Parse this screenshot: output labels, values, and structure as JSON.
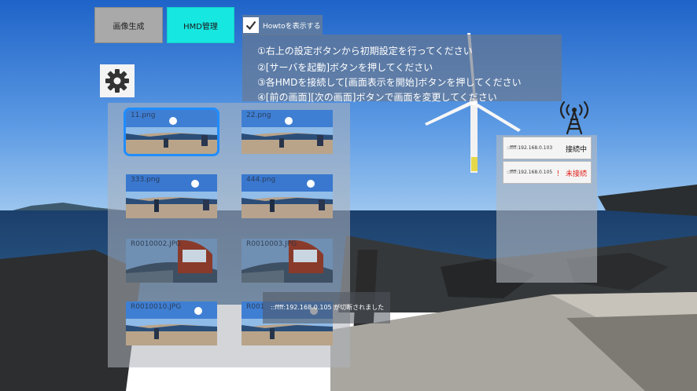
{
  "tabs": [
    {
      "label": "画像生成",
      "active": false
    },
    {
      "label": "HMD管理",
      "active": true
    }
  ],
  "howto": {
    "label": "Howtoを表示する",
    "checked": true
  },
  "instructions": [
    "①右上の設定ボタンから初期設定を行ってください",
    "②[サーバを起動]ボタンを押してください",
    "③各HMDを接続して[画面表示を開始]ボタンを押してください",
    "④[前の画面][次の画面]ボタンで画面を変更してください"
  ],
  "images": [
    {
      "name": "11.png",
      "selected": true
    },
    {
      "name": "22.png",
      "selected": false
    },
    {
      "name": "333.png",
      "selected": false
    },
    {
      "name": "444.png",
      "selected": false
    },
    {
      "name": "R0010002.JPG",
      "selected": false
    },
    {
      "name": "R0010003.JPG",
      "selected": false
    },
    {
      "name": "R0010010.JPG",
      "selected": false
    },
    {
      "name": "R001",
      "selected": false
    }
  ],
  "hmds": [
    {
      "ip": "::ffff:192.168.0.103",
      "status": "接続中",
      "status_color": "#111111"
    },
    {
      "ip": "::ffff:192.168.0.105",
      "status": "！ 未接続",
      "status_color": "#e0201a"
    }
  ],
  "toast": "::ffff:192.168.0.105 が切断されました",
  "icons": {
    "settings": "gear-icon",
    "antenna": "antenna-icon",
    "check": "checkmark-icon"
  }
}
